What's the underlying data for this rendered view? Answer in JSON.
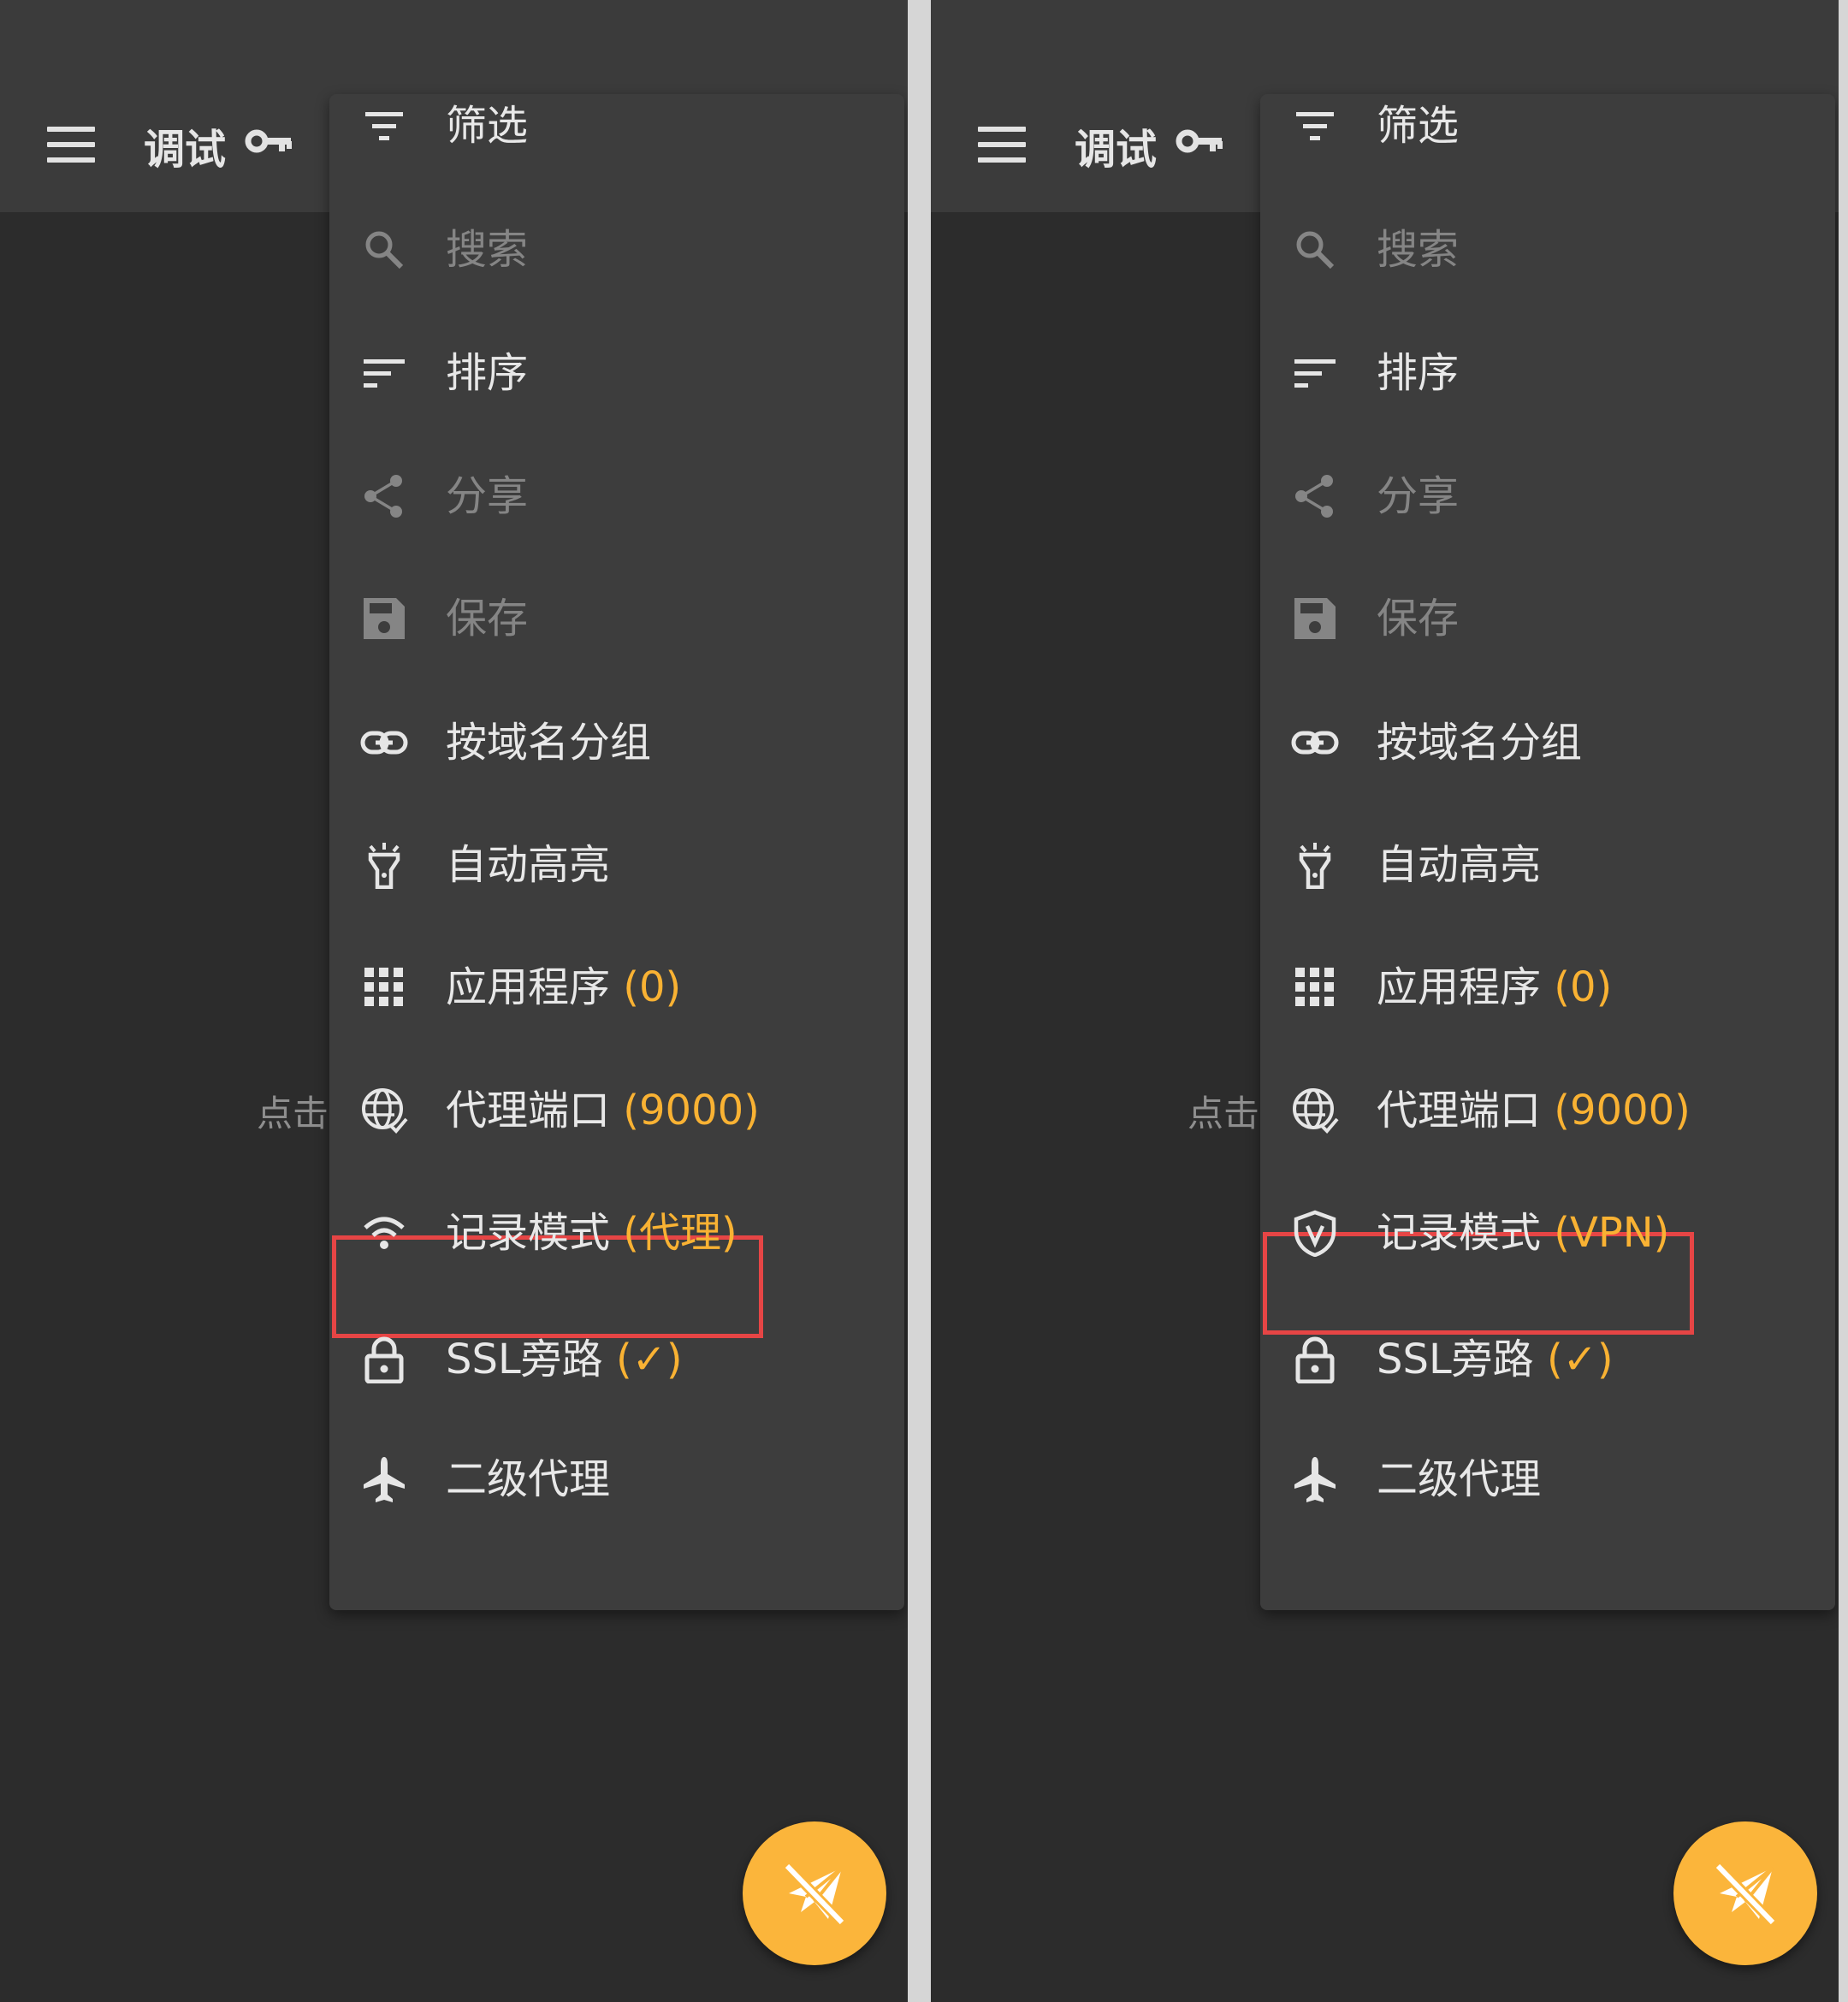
{
  "panels": [
    {
      "app_title": "调试",
      "background_hint": "点击",
      "menu": [
        {
          "icon": "filter-icon",
          "label": "筛选",
          "value": "",
          "enabled": true
        },
        {
          "icon": "search-icon",
          "label": "搜索",
          "value": "",
          "enabled": false
        },
        {
          "icon": "sort-icon",
          "label": "排序",
          "value": "",
          "enabled": true
        },
        {
          "icon": "share-icon",
          "label": "分享",
          "value": "",
          "enabled": false
        },
        {
          "icon": "save-icon",
          "label": "保存",
          "value": "",
          "enabled": false
        },
        {
          "icon": "link-icon",
          "label": "按域名分组",
          "value": "",
          "enabled": true
        },
        {
          "icon": "flashlight-icon",
          "label": "自动高亮",
          "value": "",
          "enabled": true
        },
        {
          "icon": "apps-grid-icon",
          "label": "应用程序 ",
          "value": "(0)",
          "enabled": true
        },
        {
          "icon": "globe-icon",
          "label": "代理端口 ",
          "value": "(9000)",
          "enabled": true
        },
        {
          "icon": "wifi-icon",
          "label": "记录模式 ",
          "value": "(代理)",
          "enabled": true,
          "highlighted": true
        },
        {
          "icon": "lock-icon",
          "label": "SSL旁路 ",
          "value": "(✓)",
          "enabled": true
        },
        {
          "icon": "airplane-icon",
          "label": "二级代理",
          "value": "",
          "enabled": true
        }
      ]
    },
    {
      "app_title": "调试",
      "background_hint": "点击",
      "menu": [
        {
          "icon": "filter-icon",
          "label": "筛选",
          "value": "",
          "enabled": true
        },
        {
          "icon": "search-icon",
          "label": "搜索",
          "value": "",
          "enabled": false
        },
        {
          "icon": "sort-icon",
          "label": "排序",
          "value": "",
          "enabled": true
        },
        {
          "icon": "share-icon",
          "label": "分享",
          "value": "",
          "enabled": false
        },
        {
          "icon": "save-icon",
          "label": "保存",
          "value": "",
          "enabled": false
        },
        {
          "icon": "link-icon",
          "label": "按域名分组",
          "value": "",
          "enabled": true
        },
        {
          "icon": "flashlight-icon",
          "label": "自动高亮",
          "value": "",
          "enabled": true
        },
        {
          "icon": "apps-grid-icon",
          "label": "应用程序 ",
          "value": "(0)",
          "enabled": true
        },
        {
          "icon": "globe-icon",
          "label": "代理端口 ",
          "value": "(9000)",
          "enabled": true
        },
        {
          "icon": "vpn-shield-icon",
          "label": "记录模式 ",
          "value": "(VPN)",
          "enabled": true,
          "highlighted": true
        },
        {
          "icon": "lock-icon",
          "label": "SSL旁路 ",
          "value": "(✓)",
          "enabled": true
        },
        {
          "icon": "airplane-icon",
          "label": "二级代理",
          "value": "",
          "enabled": true
        }
      ]
    }
  ],
  "colors": {
    "appbar": "#3b3b3b",
    "background": "#2c2c2c",
    "menu": "#3d3d3d",
    "accent": "#f9b233",
    "fab": "#fbb53b",
    "highlight_border": "#e64545",
    "divider": "#d6d6d6"
  }
}
